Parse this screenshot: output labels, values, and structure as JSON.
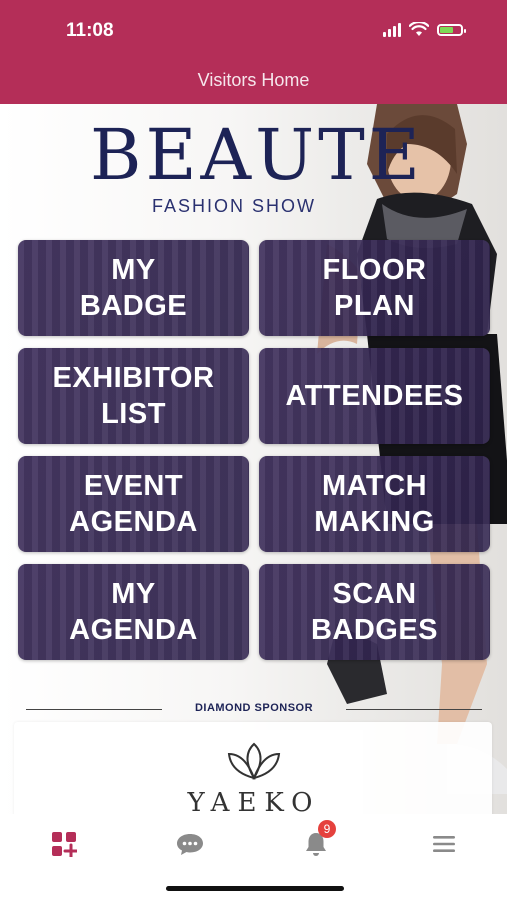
{
  "status_bar": {
    "time": "11:08",
    "battery_level": 0.7,
    "battery_color": "#7ed957"
  },
  "header": {
    "title": "Visitors Home",
    "color": "#b42e58"
  },
  "brand": {
    "title": "BEAUTE",
    "subtitle": "FASHION SHOW"
  },
  "tiles": [
    {
      "label": "MY\nBADGE"
    },
    {
      "label": "FLOOR\nPLAN"
    },
    {
      "label": "EXHIBITOR\nLIST"
    },
    {
      "label": "ATTENDEES"
    },
    {
      "label": "EVENT\nAGENDA"
    },
    {
      "label": "MATCH\nMAKING"
    },
    {
      "label": "MY\nAGENDA"
    },
    {
      "label": "SCAN\nBADGES"
    }
  ],
  "sponsor": {
    "section_label": "DIAMOND SPONSOR",
    "name": "YAEKO"
  },
  "tab_bar": {
    "items": [
      {
        "icon": "dashboard-add-icon",
        "active": true
      },
      {
        "icon": "chat-bubble-icon",
        "active": false
      },
      {
        "icon": "bell-icon",
        "active": false,
        "badge": "9"
      },
      {
        "icon": "menu-icon",
        "active": false
      }
    ],
    "active_color": "#b42e58",
    "inactive_color": "#8a8a8a"
  }
}
